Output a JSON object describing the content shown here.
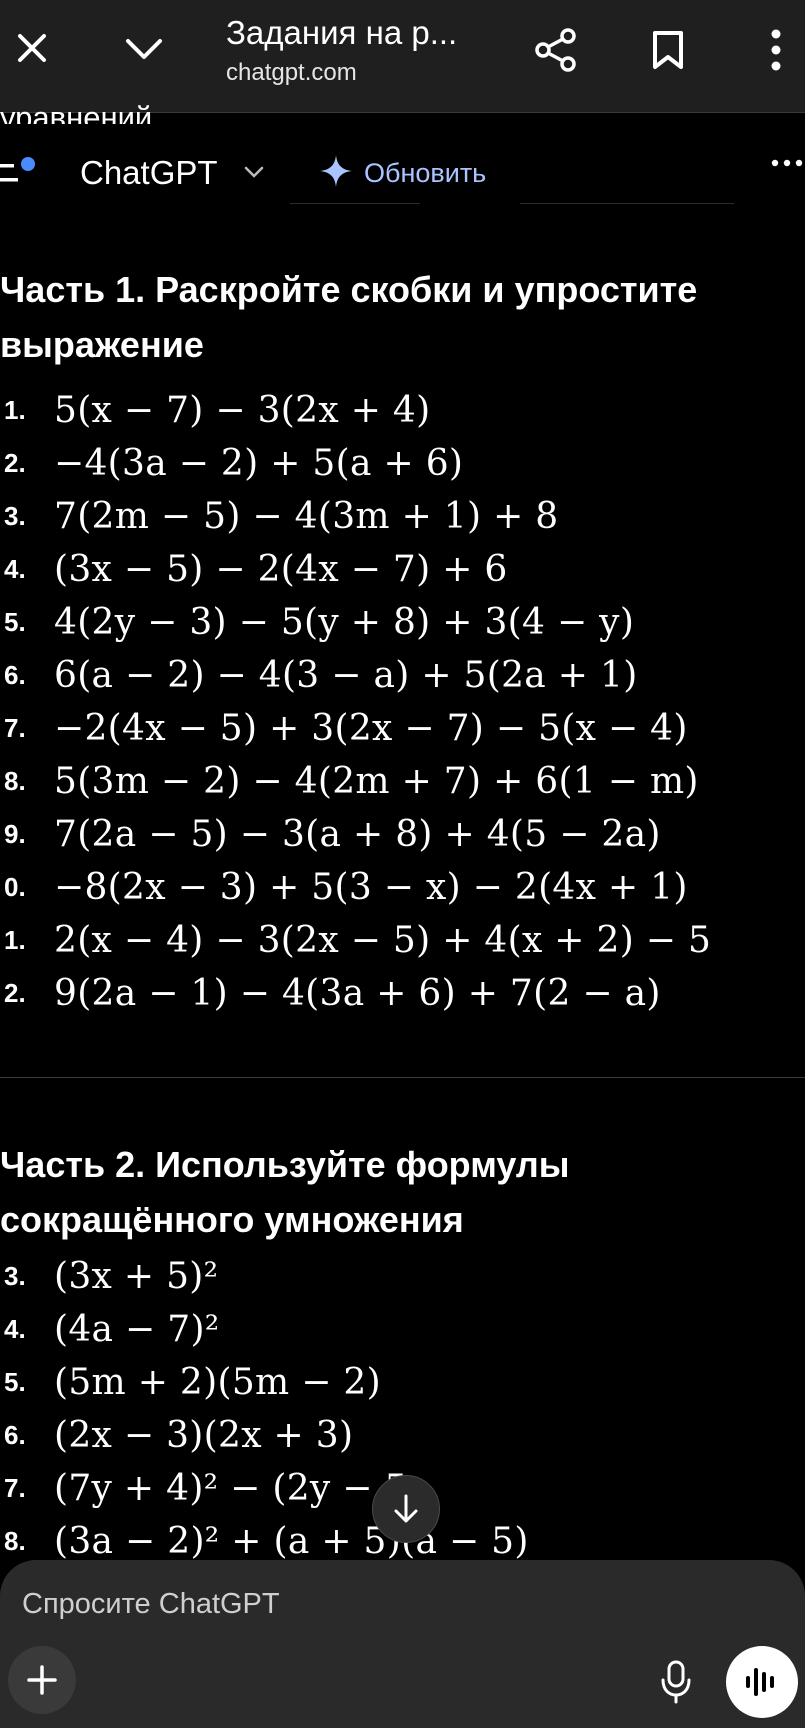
{
  "browser": {
    "title": "Задания на р...",
    "url": "chatgpt.com"
  },
  "peek_text": "уравнений.",
  "header": {
    "title": "ChatGPT",
    "upgrade_label": "Обновить"
  },
  "part1": {
    "title": "Часть 1. Раскройте скобки и упростите выражение",
    "items": [
      {
        "num": "1.",
        "expr": "5(x − 7) − 3(2x + 4)"
      },
      {
        "num": "2.",
        "expr": "−4(3a − 2) + 5(a + 6)"
      },
      {
        "num": "3.",
        "expr": "7(2m − 5) − 4(3m + 1) + 8"
      },
      {
        "num": "4.",
        "expr": "(3x − 5) − 2(4x − 7) + 6"
      },
      {
        "num": "5.",
        "expr": "4(2y − 3) − 5(y + 8) + 3(4 − y)"
      },
      {
        "num": "6.",
        "expr": "6(a − 2) − 4(3 − a) + 5(2a + 1)"
      },
      {
        "num": "7.",
        "expr": "−2(4x − 5) + 3(2x − 7) − 5(x − 4)"
      },
      {
        "num": "8.",
        "expr": "5(3m − 2) − 4(2m + 7) + 6(1 − m)"
      },
      {
        "num": "9.",
        "expr": "7(2a − 5) − 3(a + 8) + 4(5 − 2a)"
      },
      {
        "num": "0.",
        "expr": "−8(2x − 3) + 5(3 − x) − 2(4x + 1)"
      },
      {
        "num": "1.",
        "expr": "2(x − 4) − 3(2x − 5) + 4(x + 2) − 5"
      },
      {
        "num": "2.",
        "expr": "9(2a − 1) − 4(3a + 6) + 7(2 − a)"
      }
    ]
  },
  "part2": {
    "title": "Часть 2. Используйте формулы сокращённого умножения",
    "items": [
      {
        "num": "3.",
        "expr": "(3x + 5)²"
      },
      {
        "num": "4.",
        "expr": "(4a − 7)²"
      },
      {
        "num": "5.",
        "expr": "(5m + 2)(5m − 2)"
      },
      {
        "num": "6.",
        "expr": "(2x − 3)(2x + 3)"
      },
      {
        "num": "7.",
        "expr": "(7y + 4)² − (2y − 5"
      },
      {
        "num": "8.",
        "expr": "(3a − 2)² + (a + 5)(a − 5)"
      }
    ]
  },
  "composer": {
    "placeholder": "Спросите ChatGPT"
  },
  "colors": {
    "accent": "#a9c4ff",
    "dot_blue": "#4a8cff"
  }
}
